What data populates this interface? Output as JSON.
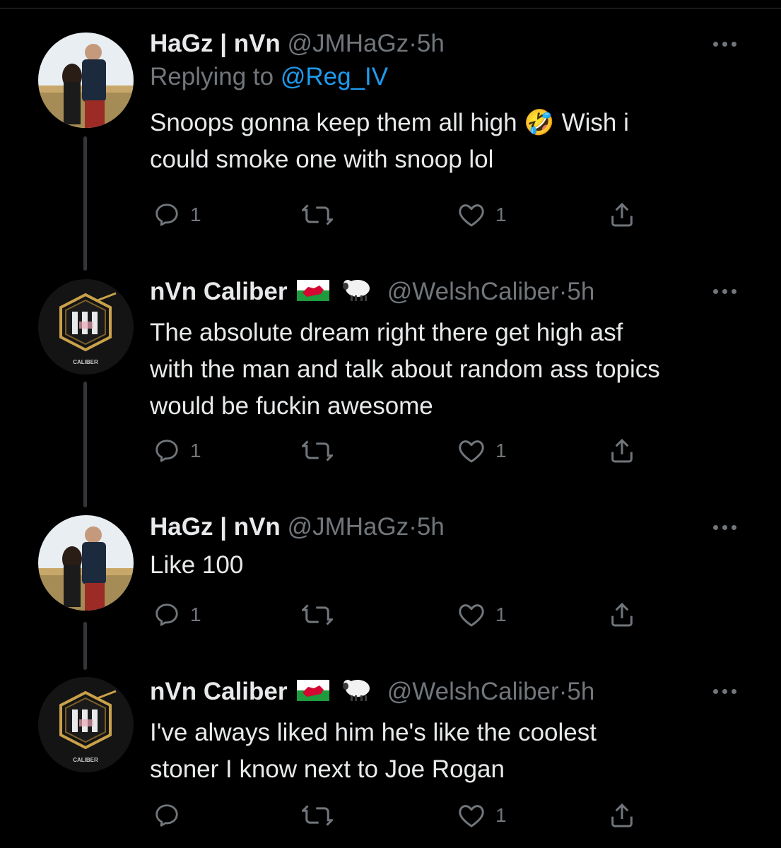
{
  "tweets": [
    {
      "name": "HaGz | nVn",
      "handle": "@JMHaGz",
      "time": "5h",
      "replying_prefix": "Replying to ",
      "replying_to": "@Reg_IV",
      "text_line1": "Snoops gonna keep them all high 🤣 Wish i",
      "text_line2": "could smoke one with snoop lol",
      "reply_count": "1",
      "retweet_count": "",
      "like_count": "1"
    },
    {
      "name": "nVn Caliber",
      "flag_emoji": "🏴󠁧󠁢󠁷󠁬󠁳󠁿",
      "sheep_emoji": "🐑",
      "handle": "@WelshCaliber",
      "time": "5h",
      "text_line1": "The absolute dream right there get high asf",
      "text_line2": "with the man and talk about random ass topics",
      "text_line3": "would be fuckin awesome",
      "reply_count": "1",
      "retweet_count": "",
      "like_count": "1",
      "avatar_label": "CALIBER"
    },
    {
      "name": "HaGz | nVn",
      "handle": "@JMHaGz",
      "time": "5h",
      "text_line1": "Like 100",
      "reply_count": "1",
      "retweet_count": "",
      "like_count": "1"
    },
    {
      "name": "nVn Caliber",
      "flag_emoji": "🏴󠁧󠁢󠁷󠁬󠁳󠁿",
      "sheep_emoji": "🐑",
      "handle": "@WelshCaliber",
      "time": "5h",
      "text_line1": "I've always liked him he's like the coolest",
      "text_line2": "stoner I know next to Joe Rogan",
      "reply_count": "",
      "retweet_count": "",
      "like_count": "1",
      "avatar_label": "CALIBER"
    }
  ],
  "separator": "·",
  "colors": {
    "background": "#000000",
    "text": "#e7e9ea",
    "muted": "#71767b",
    "link": "#1d9bf0",
    "caliber_gold": "#c9a14a"
  },
  "icons": [
    "reply-icon",
    "retweet-icon",
    "like-icon",
    "share-icon",
    "more-icon"
  ]
}
